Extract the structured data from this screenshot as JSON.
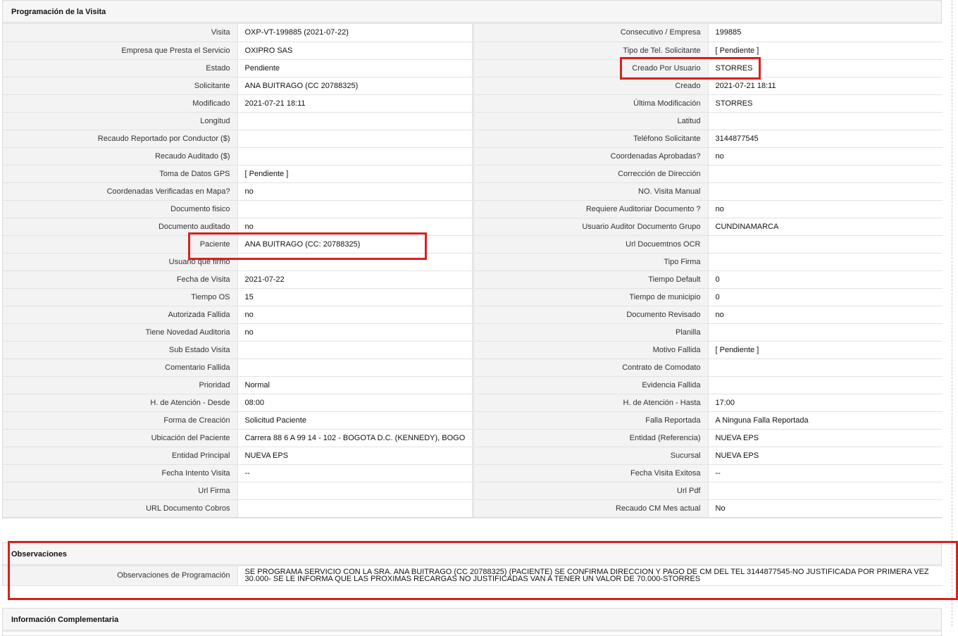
{
  "programacion": {
    "title": "Programación de la Visita",
    "rows": [
      {
        "label_left": "Visita",
        "value_left": "OXP-VT-199885 (2021-07-22)",
        "label_right": "Consecutivo / Empresa",
        "value_right": "199885"
      },
      {
        "label_left": "Empresa que Presta el Servicio",
        "value_left": "OXIPRO SAS",
        "label_right": "Tipo de Tel. Solicitante",
        "value_right": "[ Pendiente ]"
      },
      {
        "label_left": "Estado",
        "value_left": "Pendiente",
        "label_right": "Creado Por Usuario",
        "value_right": "STORRES"
      },
      {
        "label_left": "Solicitante",
        "value_left": "ANA BUITRAGO (CC 20788325)",
        "label_right": "Creado",
        "value_right": "2021-07-21 18:11"
      },
      {
        "label_left": "Modificado",
        "value_left": "2021-07-21 18:11",
        "label_right": "Última Modificación",
        "value_right": " STORRES"
      },
      {
        "label_left": "Longitud",
        "value_left": "",
        "label_right": "Latitud",
        "value_right": ""
      },
      {
        "label_left": "Recaudo Reportado por Conductor ($)",
        "value_left": "",
        "label_right": "Teléfono Solicitante",
        "value_right": "3144877545"
      },
      {
        "label_left": "Recaudo Auditado ($)",
        "value_left": "",
        "label_right": "Coordenadas Aprobadas?",
        "value_right": " no"
      },
      {
        "label_left": "Toma de Datos GPS",
        "value_left": "[ Pendiente ]",
        "label_right": "Corrección de Dirección",
        "value_right": ""
      },
      {
        "label_left": "Coordenadas Verificadas en Mapa?",
        "value_left": " no",
        "label_right": "NO. Visita Manual",
        "value_right": ""
      },
      {
        "label_left": "Documento fisico",
        "value_left": "",
        "label_right": "Requiere Auditoriar Documento ?",
        "value_right": " no"
      },
      {
        "label_left": "Documento auditado",
        "value_left": " no",
        "label_right": "Usuario Auditor Documento Grupo",
        "value_right": "CUNDINAMARCA"
      },
      {
        "label_left": "Paciente",
        "value_left": "ANA BUITRAGO (CC: 20788325)",
        "label_right": "Url Docuemtnos OCR",
        "value_right": ""
      },
      {
        "label_left": "Usuario que firmo",
        "value_left": "",
        "label_right": "Tipo Firma",
        "value_right": ""
      },
      {
        "label_left": "Fecha de Visita",
        "value_left": " 2021-07-22",
        "label_right": "Tiempo Default",
        "value_right": "0"
      },
      {
        "label_left": "Tiempo OS",
        "value_left": "15",
        "label_right": "Tiempo de municipio",
        "value_right": "0"
      },
      {
        "label_left": "Autorizada Fallida",
        "value_left": " no",
        "label_right": "Documento Revisado",
        "value_right": " no"
      },
      {
        "label_left": "Tiene Novedad Auditoria",
        "value_left": " no",
        "label_right": "Planilla",
        "value_right": ""
      },
      {
        "label_left": "Sub Estado Visita",
        "value_left": "",
        "label_right": "Motivo Fallida",
        "value_right": "[ Pendiente ]"
      },
      {
        "label_left": "Comentario Fallida",
        "value_left": "",
        "label_right": "Contrato de Comodato",
        "value_right": ""
      },
      {
        "label_left": "Prioridad",
        "value_left": "Normal",
        "label_right": "Evidencia Fallida",
        "value_right": ""
      },
      {
        "label_left": "H. de Atención - Desde",
        "value_left": "08:00",
        "label_right": "H. de Atención - Hasta",
        "value_right": "17:00"
      },
      {
        "label_left": "Forma de Creación",
        "value_left": "Solicitud Paciente",
        "label_right": "Falla Reportada",
        "value_right": "A Ninguna Falla Reportada"
      },
      {
        "label_left": "Ubicación del Paciente",
        "value_left": "Carrera 88 6 A 99 14 - 102 - BOGOTA D.C. (KENNEDY), BOGO",
        "label_right": "Entidad (Referencia)",
        "value_right": "NUEVA EPS"
      },
      {
        "label_left": "Entidad Principal",
        "value_left": "NUEVA EPS",
        "label_right": "Sucursal",
        "value_right": "NUEVA EPS"
      },
      {
        "label_left": "Fecha Intento Visita",
        "value_left": "--",
        "label_right": "Fecha Visita Exitosa",
        "value_right": "--"
      },
      {
        "label_left": "Url Firma",
        "value_left": "",
        "label_right": "Url Pdf",
        "value_right": ""
      },
      {
        "label_left": "URL Documento Cobros",
        "value_left": "",
        "label_right": "Recaudo CM Mes actual",
        "value_right": "No"
      }
    ]
  },
  "observaciones": {
    "title": "Observaciones",
    "label": "Observaciones de Programación",
    "value": "   SE PROGRAMA SERVICIO CON LA SRA. ANA BUITRAGO (CC 20788325) (PACIENTE) SE CONFIRMA DIRECCION Y PAGO DE CM DEL TEL 3144877545-NO JUSTIFICADA POR PRIMERA VEZ 30.000- SE LE INFORMA QUE LAS PROXIMAS RECARGAS NO JUSTIFICADAS VAN A TENER UN VALOR DE 70.000-STORRES"
  },
  "complementaria": {
    "title": "Información Complementaria"
  },
  "colors": {
    "highlight": "#d9201f",
    "label_bg": "#f3f3f3",
    "header_bg": "#f6f6f6"
  }
}
